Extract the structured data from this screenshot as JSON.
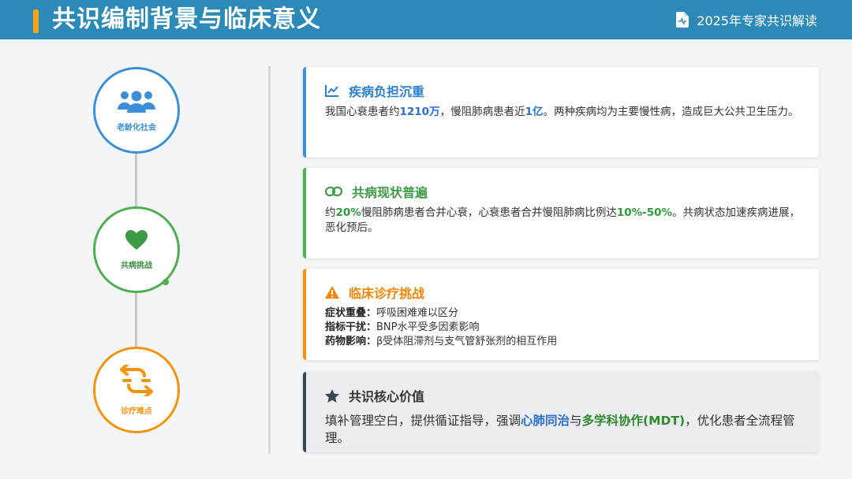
{
  "header": {
    "title": "共识编制背景与临床意义",
    "subtitle": "2025年专家共识解读",
    "icon": "document-icon"
  },
  "timeline": [
    {
      "label": "老龄化社会",
      "icon": "users-icon",
      "color": "#3b8fd9"
    },
    {
      "label": "共病挑战",
      "icon": "heart-icon",
      "color": "#4caf50"
    },
    {
      "label": "诊疗难点",
      "icon": "shuffle-arrows-icon",
      "color": "#f5930c"
    }
  ],
  "cards": {
    "burden": {
      "title": "疾病负担沉重",
      "icon": "line-chart-icon",
      "t1": "我国心衰患者约",
      "h1": "1210万",
      "t2": "，慢阻肺病患者近",
      "h2": "1亿",
      "t3": "。两种疾病均为主要慢性病，造成巨大公共卫生压力。"
    },
    "comorbidity": {
      "title": "共病现状普遍",
      "icon": "link-icon",
      "t1": "约",
      "h1": "20%",
      "t2": "慢阻肺病患者合并心衰，心衰患者合并慢阻肺病比例达",
      "h2": "10%-50%",
      "t3": "。共病状态加速疾病进展，恶化预后。"
    },
    "challenge": {
      "title": "临床诊疗挑战",
      "icon": "warning-icon",
      "rows": [
        {
          "k": "症状重叠：",
          "v": "呼吸困难难以区分"
        },
        {
          "k": "指标干扰：",
          "v": "BNP水平受多因素影响"
        },
        {
          "k": "药物影响：",
          "v": "β受体阻滞剂与支气管舒张剂的相互作用"
        }
      ]
    },
    "value": {
      "title": "共识核心价值",
      "icon": "star-icon",
      "t1": "填补管理空白，提供循证指导，强调",
      "h1": "心肺同治",
      "t2": "与",
      "h2": "多学科协作(MDT)",
      "t3": "，优化患者全流程管理。"
    }
  },
  "colors": {
    "header_bg": "#2c8ab8",
    "accent": "#f5a31a",
    "blue": "#3b8fd9",
    "green": "#4caf50",
    "orange": "#f5930c",
    "dark": "#37474f"
  }
}
